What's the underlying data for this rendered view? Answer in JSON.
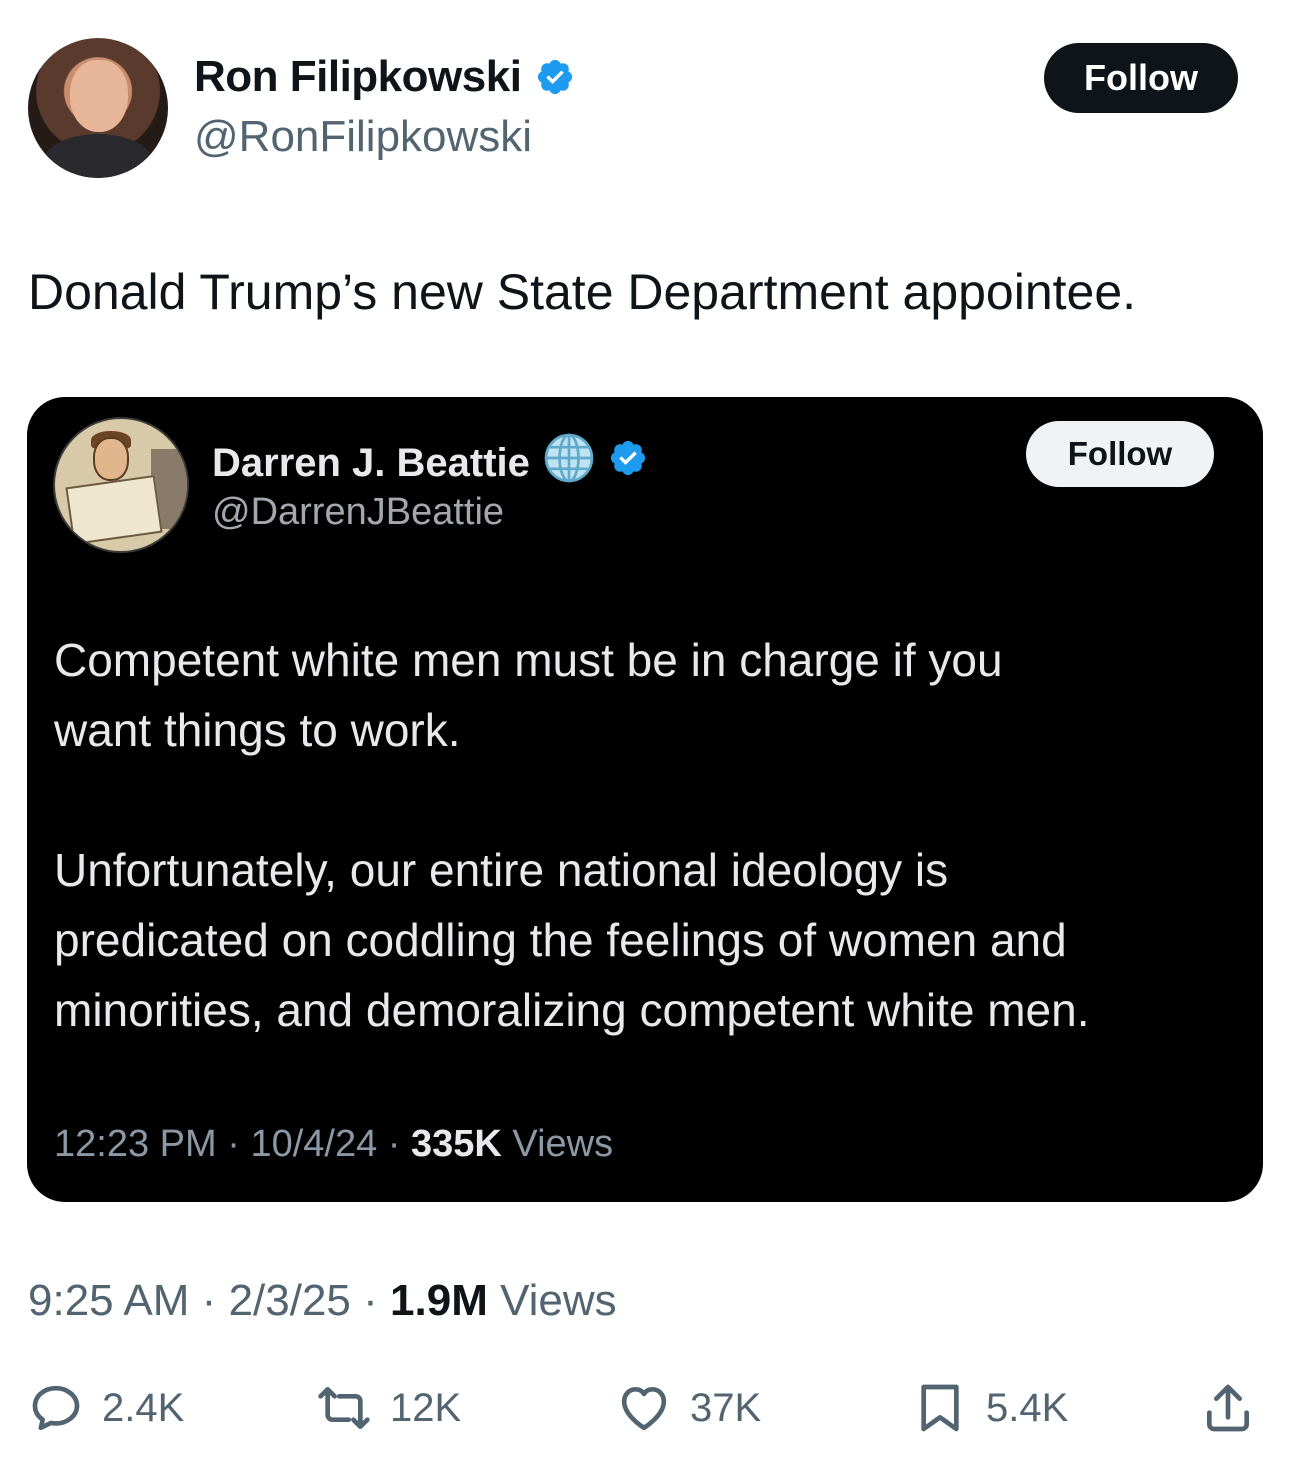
{
  "author": {
    "name": "Ron Filipkowski",
    "handle": "@RonFilipkowski",
    "verified": true,
    "follow_label": "Follow"
  },
  "tweet": {
    "text": "Donald Trump’s new State Department appointee.",
    "time": "9:25 AM",
    "date": "2/3/25",
    "views_count": "1.9M",
    "views_label": "Views",
    "separator": "·"
  },
  "quoted": {
    "name": "Darren J. Beattie",
    "handle": "@DarrenJBeattie",
    "follow_label": "Follow",
    "paragraph1_line1": "Competent white men must be in charge if you",
    "paragraph1_line2": "want things to work.",
    "paragraph2_line1": "Unfortunately, our entire national ideology is",
    "paragraph2_line2": "predicated on coddling the feelings of women and",
    "paragraph2_line3": "minorities, and demoralizing competent white men.",
    "time": "12:23 PM",
    "date": "10/4/24",
    "views_count": "335K",
    "views_label": "Views",
    "separator": "·"
  },
  "actions": {
    "replies": "2.4K",
    "reposts": "12K",
    "likes": "37K",
    "bookmarks": "5.4K"
  },
  "colors": {
    "verified_blue": "#1d9bf0",
    "secondary_text": "#536471",
    "primary_text": "#0f1419"
  }
}
